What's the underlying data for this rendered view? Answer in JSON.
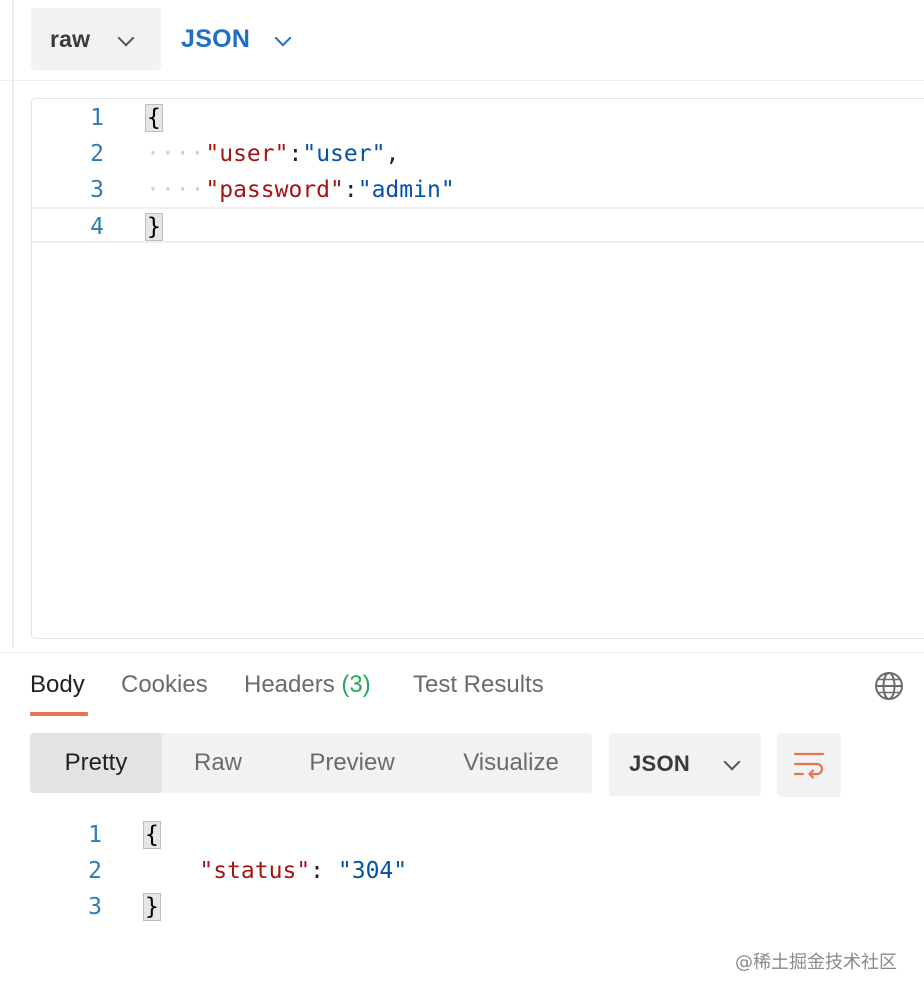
{
  "request": {
    "body_mode": "raw",
    "body_format": "JSON",
    "lines": [
      {
        "num": "1",
        "text": "{"
      },
      {
        "num": "2",
        "key": "\"user\"",
        "sep": ":",
        "value": "\"user\"",
        "trail": ","
      },
      {
        "num": "3",
        "key": "\"password\"",
        "sep": ":",
        "value": "\"admin\"",
        "trail": ""
      },
      {
        "num": "4",
        "text": "}"
      }
    ]
  },
  "response": {
    "tabs": [
      {
        "label": "Body"
      },
      {
        "label": "Cookies"
      },
      {
        "label": "Headers",
        "count": "(3)"
      },
      {
        "label": "Test Results"
      }
    ],
    "views": [
      "Pretty",
      "Raw",
      "Preview",
      "Visualize"
    ],
    "format": "JSON",
    "lines": [
      {
        "num": "1",
        "text": "{"
      },
      {
        "num": "2",
        "key": "\"status\"",
        "sep": ": ",
        "value": "\"304\""
      },
      {
        "num": "3",
        "text": "}"
      }
    ]
  },
  "watermark": "@稀土掘金技术社区",
  "colors": {
    "accent": "#e8744f",
    "link_blue": "#1f6fc6",
    "json_key": "#a31515",
    "json_value": "#0451a5",
    "count_green": "#28a85a"
  },
  "icons": [
    "chevron-down-icon",
    "globe-icon",
    "wrap-text-icon"
  ]
}
